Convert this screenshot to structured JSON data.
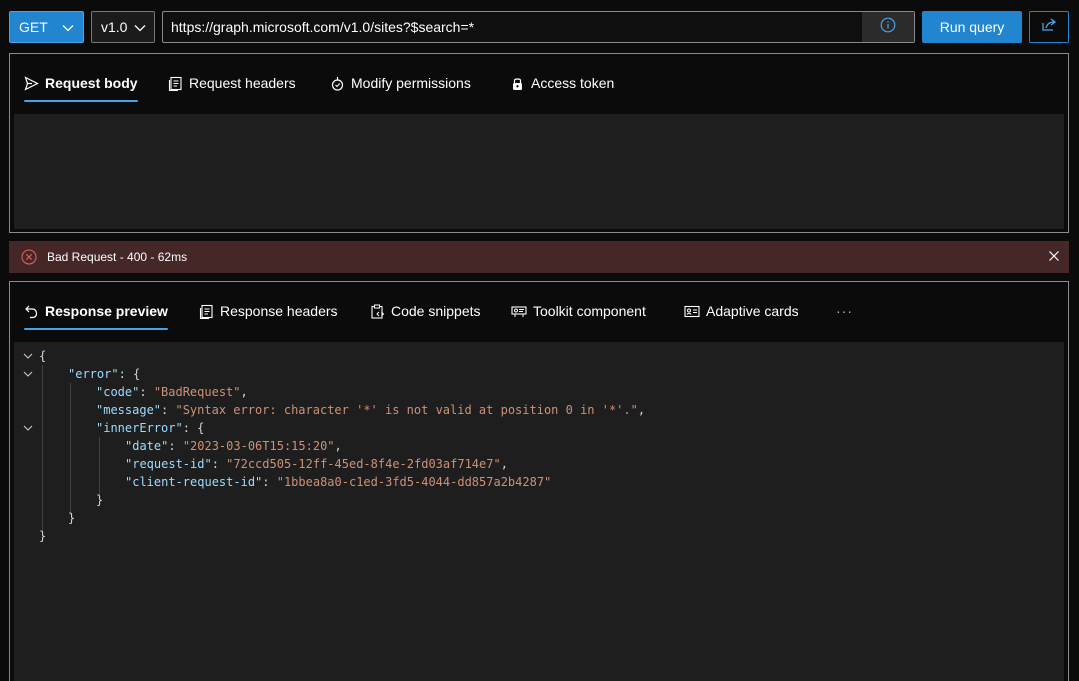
{
  "toolbar": {
    "method": "GET",
    "version": "v1.0",
    "url": "https://graph.microsoft.com/v1.0/sites?$search=*",
    "run_label": "Run query"
  },
  "request_tabs": [
    {
      "label": "Request body",
      "icon": "send-icon",
      "active": true
    },
    {
      "label": "Request headers",
      "icon": "document-icon",
      "active": false
    },
    {
      "label": "Modify permissions",
      "icon": "shield-icon",
      "active": false
    },
    {
      "label": "Access token",
      "icon": "lock-icon",
      "active": false
    }
  ],
  "status": {
    "text": "Bad Request - 400 - 62ms",
    "color": "#442726"
  },
  "response_tabs": [
    {
      "label": "Response preview",
      "icon": "undo-icon",
      "active": true
    },
    {
      "label": "Response headers",
      "icon": "document-icon",
      "active": false
    },
    {
      "label": "Code snippets",
      "icon": "clipboard-code-icon",
      "active": false
    },
    {
      "label": "Toolkit component",
      "icon": "component-icon",
      "active": false
    },
    {
      "label": "Adaptive cards",
      "icon": "card-icon",
      "active": false
    },
    {
      "label": "···",
      "icon": "more-icon",
      "active": false
    }
  ],
  "response": {
    "open_brace": "{",
    "error_key": "\"error\"",
    "code_key": "\"code\"",
    "code_value": "\"BadRequest\"",
    "message_key": "\"message\"",
    "message_value": "\"Syntax error: character '*' is not valid at position 0 in '*'.\"",
    "inner_key": "\"innerError\"",
    "date_key": "\"date\"",
    "date_value": "\"2023-03-06T15:15:20\"",
    "request_id_key": "\"request-id\"",
    "request_id_value": "\"72ccd505-12ff-45ed-8f4e-2fd03af714e7\"",
    "client_request_id_key": "\"client-request-id\"",
    "client_request_id_value": "\"1bbea8a0-c1ed-3fd5-4044-dd857a2b4287\"",
    "close_brace": "}"
  },
  "colors": {
    "accent": "#2185d0",
    "json_key": "#9cdcfe",
    "json_string": "#ce9178",
    "error_icon": "#e06060"
  }
}
